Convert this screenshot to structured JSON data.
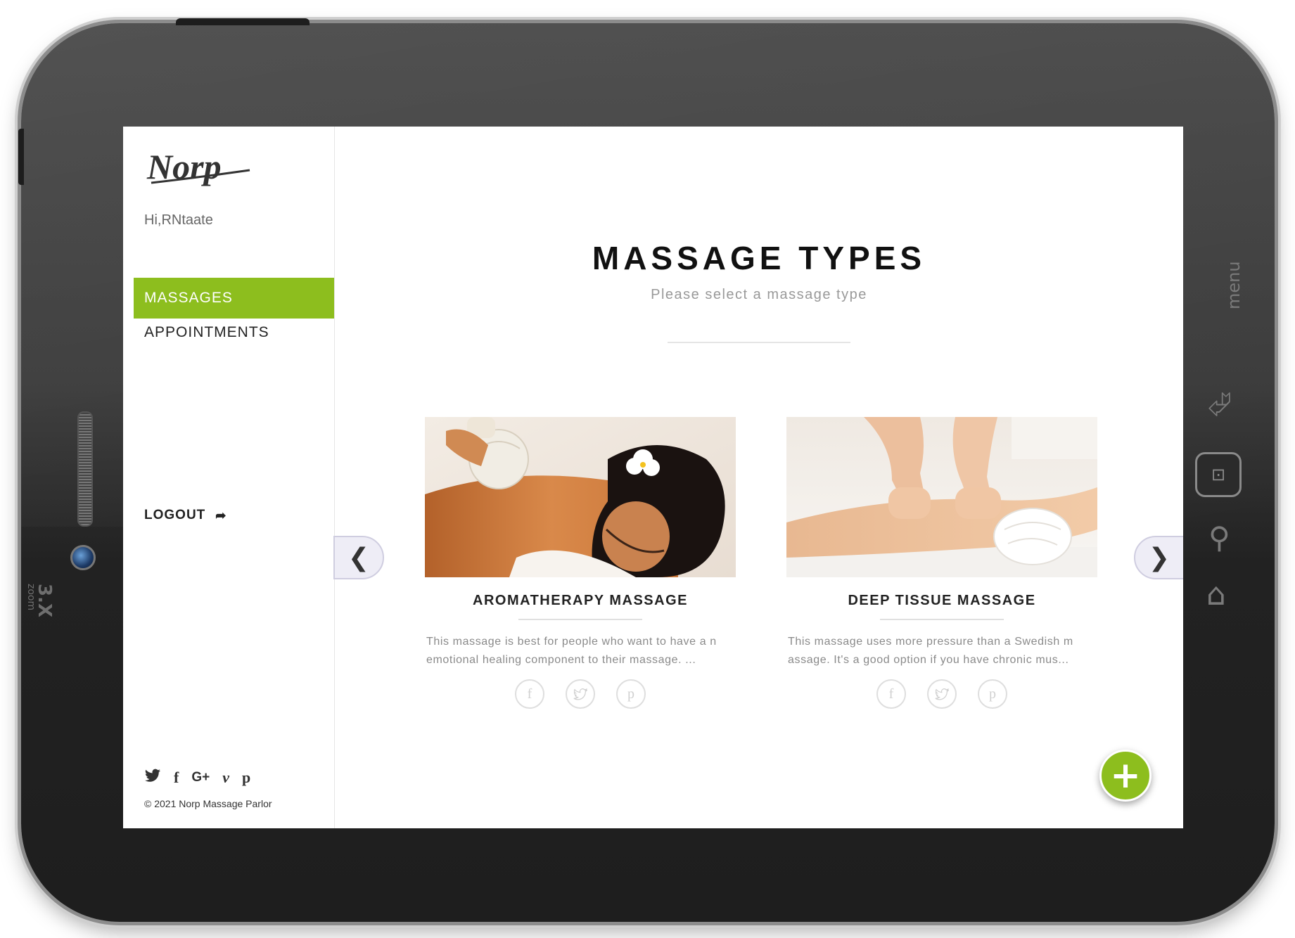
{
  "device": {
    "zoom_label": "3.X",
    "zoom_sub": "zoom",
    "menu_label": "menu"
  },
  "sidebar": {
    "logo_text": "Norp",
    "greeting": "Hi,RNtaate",
    "nav": [
      {
        "label": "MASSAGES",
        "active": true
      },
      {
        "label": "APPOINTMENTS",
        "active": false
      },
      {
        "label": "LOGOUT",
        "active": false
      }
    ],
    "social": [
      "twitter-icon",
      "facebook-icon",
      "google-plus-icon",
      "vimeo-icon",
      "pinterest-icon"
    ],
    "copyright": "© 2021 Norp Massage Parlor"
  },
  "main": {
    "title": "MASSAGE TYPES",
    "subtitle": "Please select a massage type",
    "cards": [
      {
        "title": "AROMATHERAPY MASSAGE",
        "description": "This massage is best for people who want to have a n emotional healing component to their massage. ...",
        "social": [
          "facebook-icon",
          "twitter-icon",
          "pinterest-icon"
        ]
      },
      {
        "title": "DEEP TISSUE MASSAGE",
        "description": "This massage uses more pressure than a Swedish m assage. It's a good option if you have chronic mus...",
        "social": [
          "facebook-icon",
          "twitter-icon",
          "pinterest-icon"
        ]
      }
    ],
    "prev_glyph": "❮",
    "next_glyph": "❯",
    "add_glyph": "+"
  },
  "colors": {
    "accent": "#8dbe1e",
    "frame": "#3a3a3a",
    "arrow_bg": "#eeedf6"
  }
}
